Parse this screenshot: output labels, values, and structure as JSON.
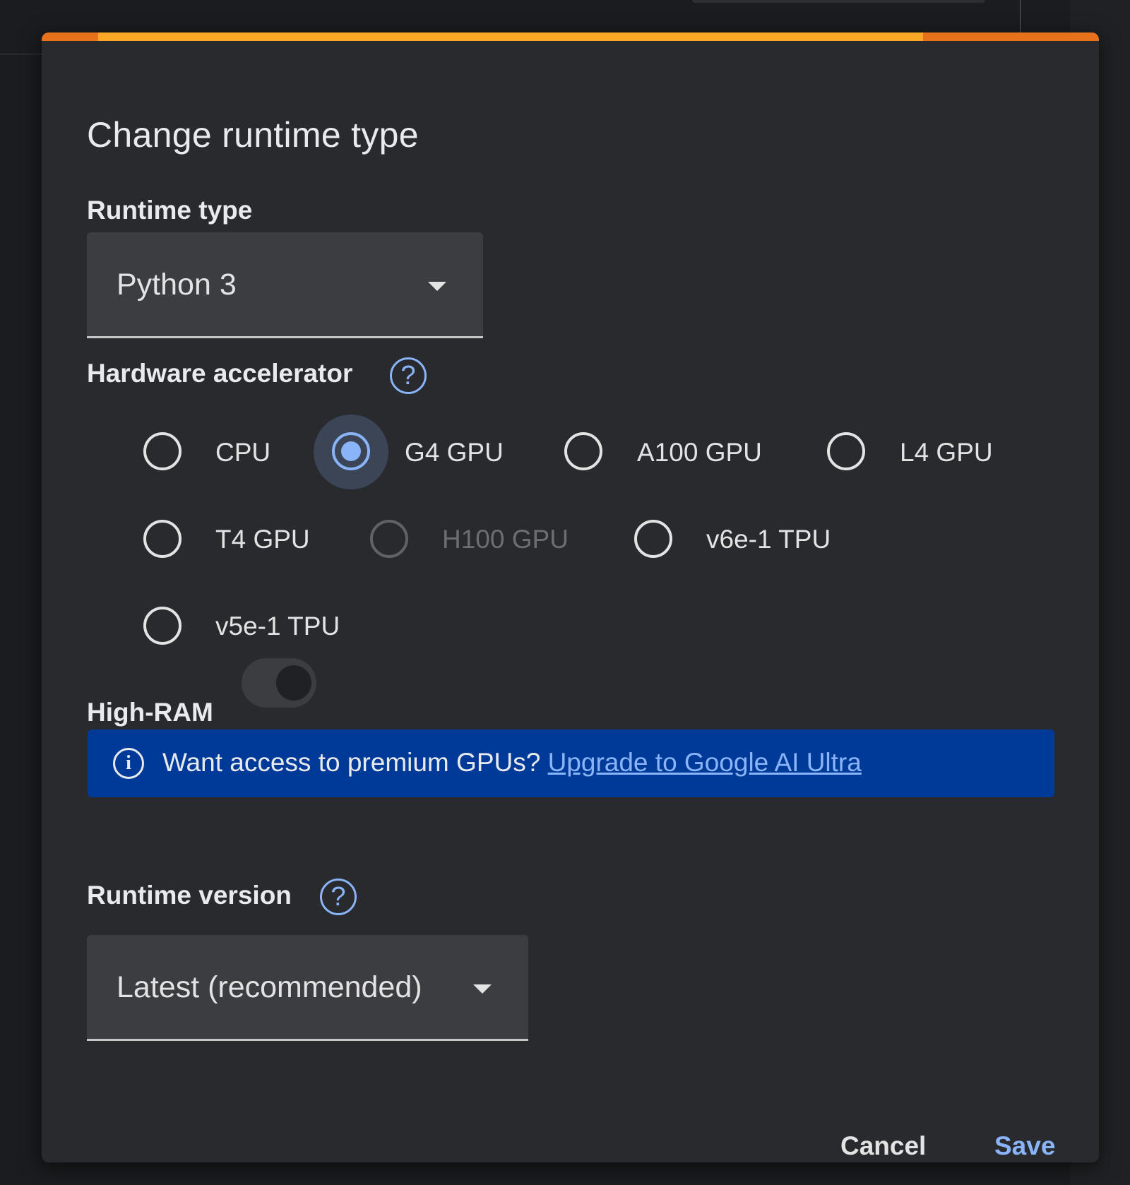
{
  "dialog": {
    "title": "Change runtime type",
    "progress_percent": 78,
    "runtime_type": {
      "label": "Runtime type",
      "value": "Python 3"
    },
    "hardware_accelerator": {
      "label": "Hardware accelerator",
      "options": [
        {
          "label": "CPU",
          "selected": false,
          "disabled": false
        },
        {
          "label": "G4 GPU",
          "selected": true,
          "disabled": false
        },
        {
          "label": "A100 GPU",
          "selected": false,
          "disabled": false
        },
        {
          "label": "L4 GPU",
          "selected": false,
          "disabled": false
        },
        {
          "label": "T4 GPU",
          "selected": false,
          "disabled": false
        },
        {
          "label": "H100 GPU",
          "selected": false,
          "disabled": true
        },
        {
          "label": "v6e-1 TPU",
          "selected": false,
          "disabled": false
        },
        {
          "label": "v5e-1 TPU",
          "selected": false,
          "disabled": false
        }
      ]
    },
    "high_ram": {
      "label": "High-RAM",
      "enabled": false
    },
    "banner": {
      "icon": "info-icon",
      "text": "Want access to premium GPUs?",
      "link": "Upgrade to Google AI Ultra"
    },
    "runtime_version": {
      "label": "Runtime version",
      "value": "Latest (recommended)"
    },
    "buttons": {
      "cancel": "Cancel",
      "save": "Save"
    }
  },
  "colors": {
    "accent": "#8ab4f8",
    "progress_orange": "#e8711c",
    "progress_yellow": "#f9a825",
    "banner_bg": "#003a99"
  }
}
